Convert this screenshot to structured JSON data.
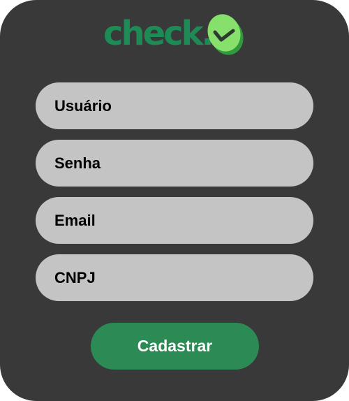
{
  "brand": {
    "logo_text": "check.",
    "logo_color": "#1e8a55",
    "logo_icon": "check-badge-icon"
  },
  "form": {
    "fields": [
      {
        "placeholder": "Usuário"
      },
      {
        "placeholder": "Senha"
      },
      {
        "placeholder": "Email"
      },
      {
        "placeholder": "CNPJ"
      }
    ],
    "submit_label": "Cadastrar"
  },
  "colors": {
    "card_background": "#393939",
    "field_background": "#c4c4c4",
    "button_background": "#2c8a55",
    "accent_light": "#86e06b"
  }
}
